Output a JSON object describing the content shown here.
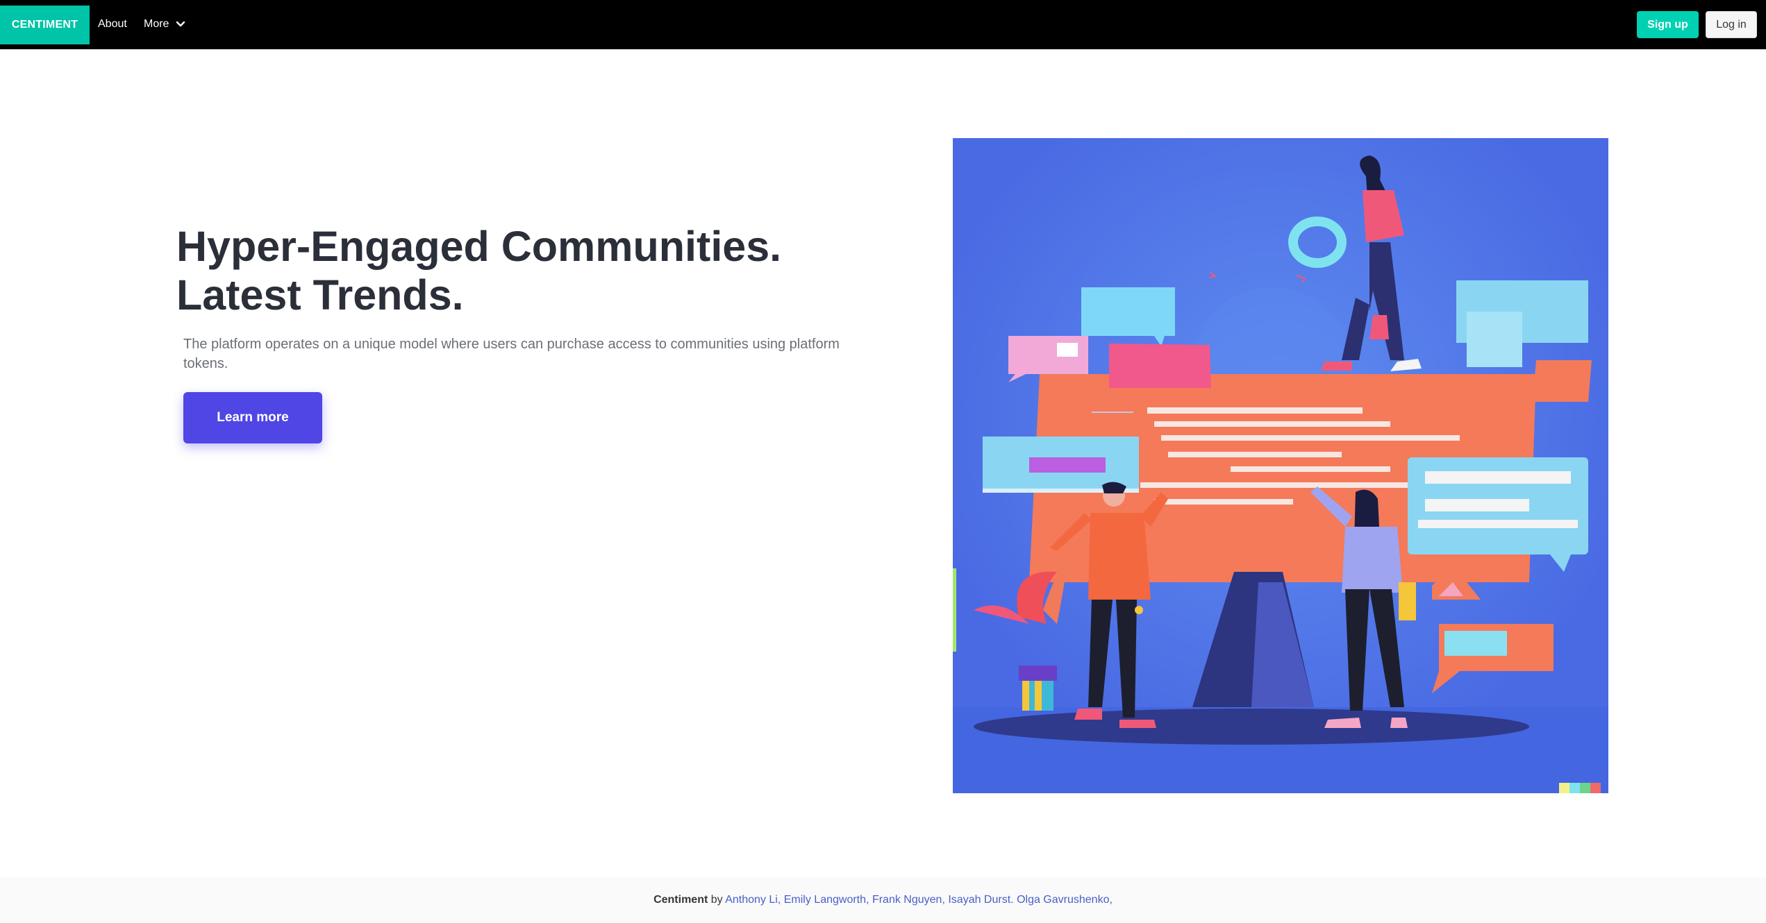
{
  "navbar": {
    "brand": "CENTIMENT",
    "links": [
      {
        "label": "About"
      },
      {
        "label": "More"
      }
    ],
    "signup_label": "Sign up",
    "login_label": "Log in",
    "more_icon": "chevron-down-icon"
  },
  "hero": {
    "title_line1": "Hyper-Engaged Communities.",
    "title_line2": "Latest Trends.",
    "description": "The platform operates on a unique model where users can purchase access to communities using platform tokens.",
    "cta_label": "Learn more"
  },
  "footer": {
    "brand": "Centiment",
    "by": "by",
    "authors": [
      "Anthony Li",
      "Emily Langworth",
      "Frank Nguyen",
      "Isayah Durst",
      "Olga Gavrushenko"
    ]
  },
  "colors": {
    "navbar_bg": "#000000",
    "brand_bg": "#00c4a7",
    "signup_bg": "#00d1b2",
    "cta_bg": "#4f46e5",
    "title_color": "#2b2f3a",
    "illustration_bg": "#4a6ae3",
    "link_color": "#485fc7"
  }
}
